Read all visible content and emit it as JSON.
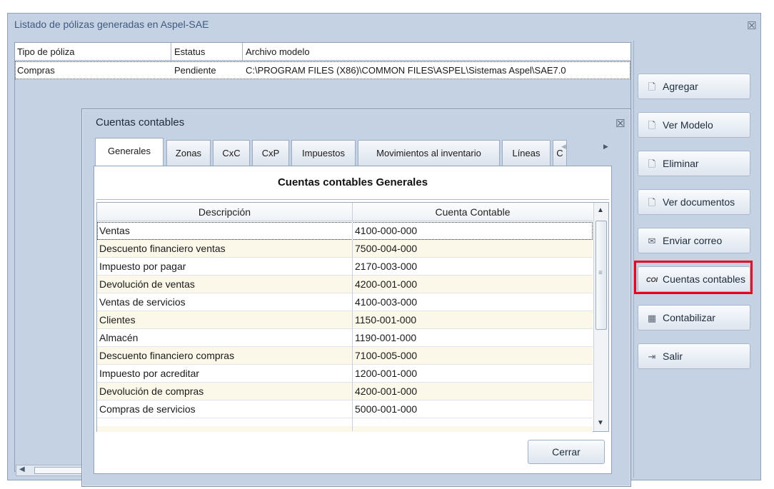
{
  "window": {
    "title": "Listado de pólizas generadas en Aspel-SAE",
    "close_glyph": "☒"
  },
  "outer_grid": {
    "columns": [
      "Tipo de póliza",
      "Estatus",
      "Archivo modelo"
    ],
    "rows": [
      {
        "tipo": "Compras",
        "estatus": "Pendiente",
        "archivo": "C:\\PROGRAM FILES (X86)\\COMMON FILES\\ASPEL\\Sistemas Aspel\\SAE7.0"
      }
    ]
  },
  "right_panel": {
    "buttons": [
      {
        "label": "Agregar",
        "icon": "add-document-icon",
        "glyph": "🗋"
      },
      {
        "label": "Ver Modelo",
        "icon": "view-model-icon",
        "glyph": "🗋"
      },
      {
        "label": "Eliminar",
        "icon": "delete-document-icon",
        "glyph": "🗋"
      },
      {
        "label": "Ver documentos",
        "icon": "view-documents-icon",
        "glyph": "🗋"
      },
      {
        "label": "Enviar correo",
        "icon": "mail-icon",
        "glyph": "✉"
      },
      {
        "label": "Cuentas contables",
        "icon": "coi-icon",
        "glyph": "COI"
      },
      {
        "label": "Contabilizar",
        "icon": "post-accounting-icon",
        "glyph": "▦"
      },
      {
        "label": "Salir",
        "icon": "exit-icon",
        "glyph": "⇥"
      }
    ],
    "highlight_color": "#e8001c"
  },
  "dialog": {
    "title": "Cuentas contables",
    "close_glyph": "☒",
    "tabs": [
      "Generales",
      "Zonas",
      "CxC",
      "CxP",
      "Impuestos",
      "Movimientos al inventario",
      "Líneas",
      "C"
    ],
    "active_tab": "Generales",
    "section_title": "Cuentas contables Generales",
    "grid": {
      "columns": [
        "Descripción",
        "Cuenta Contable"
      ],
      "rows": [
        {
          "descripcion": "Ventas",
          "cuenta": "4100-000-000"
        },
        {
          "descripcion": "Descuento financiero ventas",
          "cuenta": "7500-004-000"
        },
        {
          "descripcion": "Impuesto por pagar",
          "cuenta": "2170-003-000"
        },
        {
          "descripcion": "Devolución de ventas",
          "cuenta": "4200-001-000"
        },
        {
          "descripcion": "Ventas de servicios",
          "cuenta": "4100-003-000"
        },
        {
          "descripcion": "Clientes",
          "cuenta": "1150-001-000"
        },
        {
          "descripcion": "Almacén",
          "cuenta": "1190-001-000"
        },
        {
          "descripcion": "Descuento financiero compras",
          "cuenta": "7100-005-000"
        },
        {
          "descripcion": "Impuesto por acreditar",
          "cuenta": "1200-001-000"
        },
        {
          "descripcion": "Devolución de compras",
          "cuenta": "4200-001-000"
        },
        {
          "descripcion": "Compras de servicios",
          "cuenta": "5000-001-000"
        }
      ]
    },
    "close_button": "Cerrar"
  }
}
